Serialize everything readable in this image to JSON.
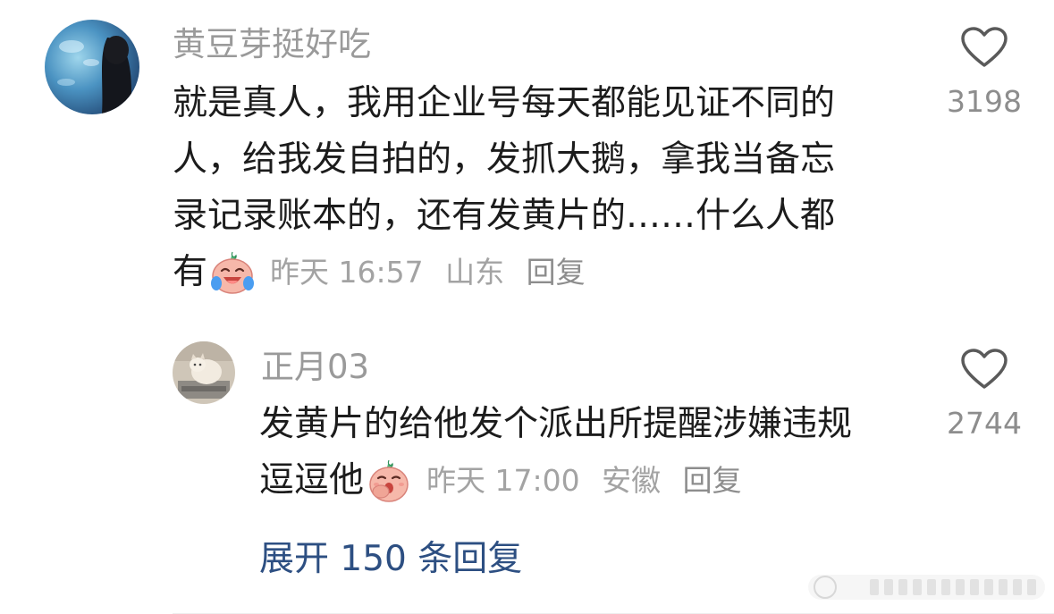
{
  "comment": {
    "username": "黄豆芽挺好吃",
    "lines": [
      "就是真人，我用企业号每天都能见证不同的",
      "人，给我发自拍的，发抓大鹅，拿我当备忘",
      "录记录账本的，还有发黄片的……什么人都"
    ],
    "last_line": "有",
    "emoji": "crying-laughing-peach-emoji",
    "time": "昨天 16:57",
    "location": "山东",
    "reply_label": "回复",
    "likes": "3198",
    "like_icon": "heart-outline-icon"
  },
  "reply": {
    "username": "正月03",
    "lines": [
      "发黄片的给他发个派出所提醒涉嫌违规"
    ],
    "last_line": "逗逗他",
    "emoji": "snickering-peach-emoji",
    "time": "昨天 17:00",
    "location": "安徽",
    "reply_label": "回复",
    "likes": "2744",
    "like_icon": "heart-outline-icon"
  },
  "expand_replies": "展开 150 条回复",
  "colors": {
    "text": "#1c1c1c",
    "meta": "#a3a3a3",
    "username": "#9a9a9a",
    "link": "#2d4f82"
  }
}
